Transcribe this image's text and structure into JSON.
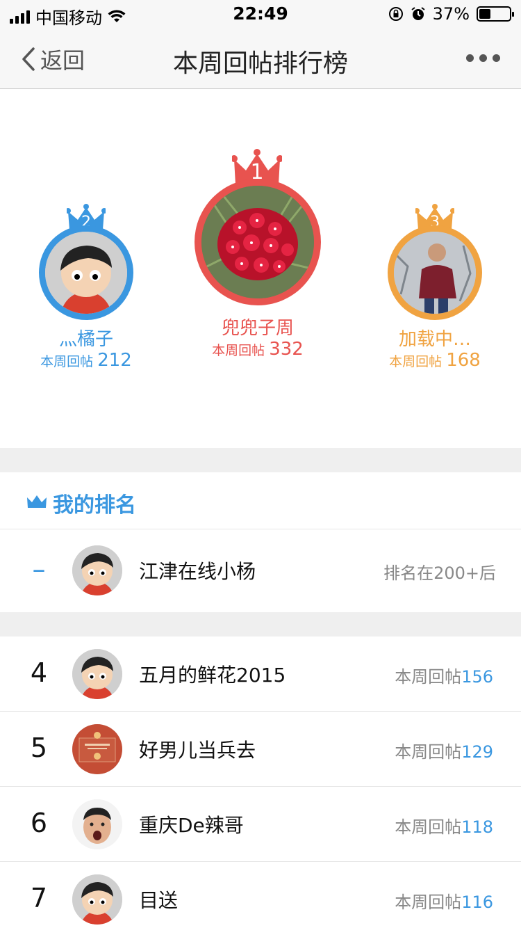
{
  "status_bar": {
    "carrier": "中国移动",
    "time": "22:49",
    "battery": "37%"
  },
  "nav": {
    "back_label": "返回",
    "title": "本周回帖排行榜"
  },
  "podium": {
    "first": {
      "rank": "1",
      "name": "兜兜子周",
      "label": "本周回帖",
      "count": "332",
      "color": "#e8534f"
    },
    "second": {
      "rank": "2",
      "name": "灬橘子",
      "label": "本周回帖",
      "count": "212",
      "color": "#3a97e0"
    },
    "third": {
      "rank": "3",
      "name": "加载中…",
      "label": "本周回帖",
      "count": "168",
      "color": "#f0a341"
    }
  },
  "my_rank": {
    "header": "我的排名",
    "rank": "–",
    "name": "江津在线小杨",
    "status": "排名在200+后"
  },
  "list": [
    {
      "rank": "4",
      "name": "五月的鲜花2015",
      "label": "本周回帖",
      "count": "156"
    },
    {
      "rank": "5",
      "name": "好男儿当兵去",
      "label": "本周回帖",
      "count": "129"
    },
    {
      "rank": "6",
      "name": "重庆De辣哥",
      "label": "本周回帖",
      "count": "118"
    },
    {
      "rank": "7",
      "name": "目送",
      "label": "本周回帖",
      "count": "116"
    }
  ],
  "colors": {
    "accent": "#3a97e0",
    "first": "#e8534f",
    "second": "#3a97e0",
    "third": "#f0a341"
  }
}
